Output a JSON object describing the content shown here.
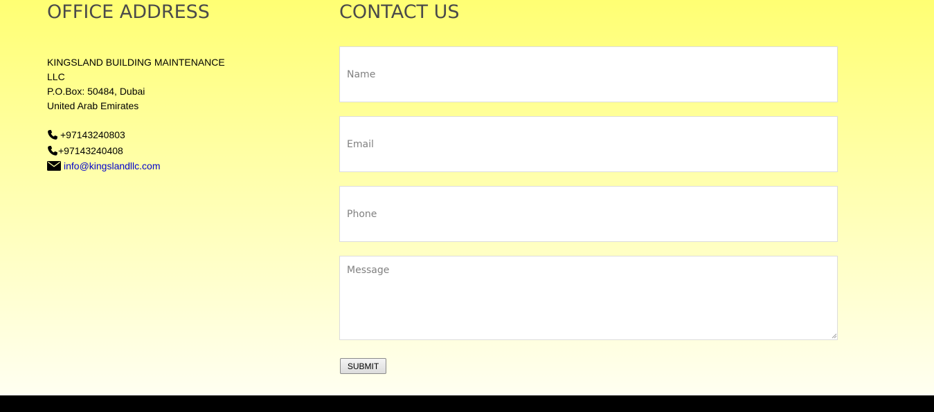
{
  "office": {
    "heading": "OFFICE ADDRESS",
    "address_lines": [
      "KINGSLAND BUILDING MAINTENANCE",
      "LLC",
      "P.O.Box: 50484, Dubai",
      "United Arab Emirates"
    ],
    "phone_1": " +97143240803",
    "phone_2": "+97143240408",
    "email": "info@kingslandllc.com",
    "icons": [
      "phone-icon",
      "phone-icon",
      "envelope-icon"
    ],
    "link_color": "#0000cc"
  },
  "contact": {
    "heading": "CONTACT US",
    "name_placeholder": "Name",
    "email_placeholder": "Email",
    "phone_placeholder": "Phone",
    "message_placeholder": "Message",
    "submit_label": "SUBMIT"
  },
  "colors": {
    "background_top": "#ffff73",
    "background_bottom": "#ffffff",
    "heading": "#4a4a4a",
    "footer": "#000000"
  }
}
